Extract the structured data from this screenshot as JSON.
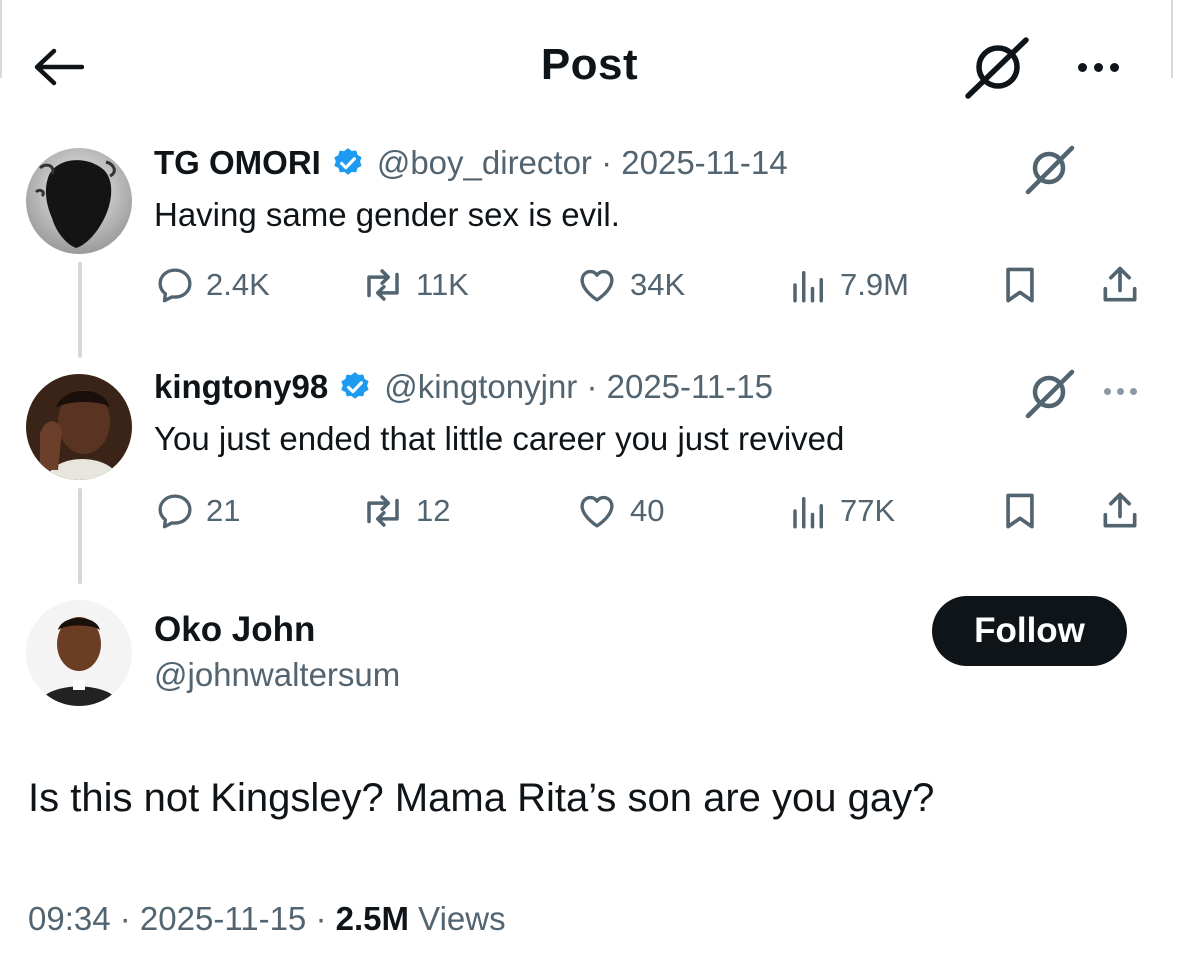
{
  "header": {
    "title": "Post"
  },
  "thread": [
    {
      "name": "TG OMORI",
      "handle": "@boy_director",
      "date": "2025-11-14",
      "text": "Having same gender sex is evil.",
      "replies": "2.4K",
      "reposts": "11K",
      "likes": "34K",
      "views": "7.9M"
    },
    {
      "name": "kingtony98",
      "handle": "@kingtonyjnr",
      "date": "2025-11-15",
      "text": "You just ended that little career you just revived",
      "replies": "21",
      "reposts": "12",
      "likes": "40",
      "views": "77K"
    }
  ],
  "main_post": {
    "name": "Oko John",
    "handle": "@johnwaltersum",
    "follow_label": "Follow",
    "text": "Is this not Kingsley? Mama Rita’s son are you gay?",
    "time": "09:34",
    "date": "2025-11-15",
    "views_count": "2.5M",
    "views_label": "Views"
  },
  "colors": {
    "text_primary": "#0f1419",
    "text_secondary": "#536471",
    "verified_blue": "#1d9bf0",
    "thread_line": "#cfd9de"
  },
  "icons": [
    "back-arrow-icon",
    "grok-icon",
    "more-icon",
    "verified-badge-icon",
    "reply-icon",
    "repost-icon",
    "like-icon",
    "views-icon",
    "bookmark-icon",
    "share-icon"
  ]
}
